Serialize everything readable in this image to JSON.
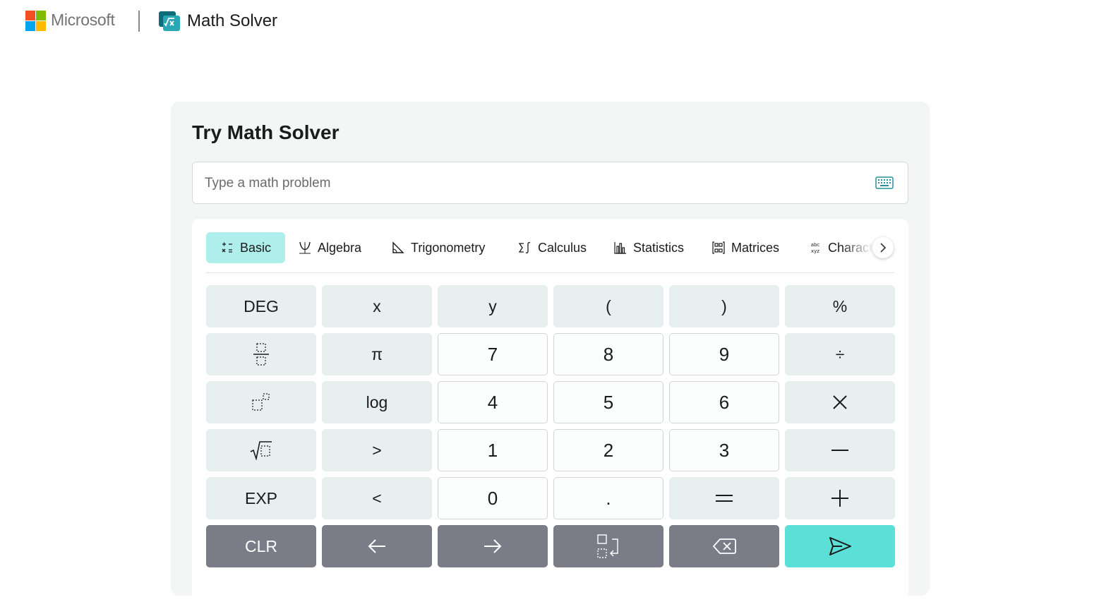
{
  "header": {
    "brand": "Microsoft",
    "app_name": "Math Solver",
    "logo_colors": [
      "#f25022",
      "#7fba00",
      "#00a4ef",
      "#ffb900"
    ]
  },
  "card": {
    "title": "Try Math Solver",
    "input": {
      "value": "",
      "placeholder": "Type a math problem",
      "icon": "keyboard-icon"
    }
  },
  "tabs": [
    {
      "label": "Basic",
      "icon": "basic-ops-icon",
      "active": true
    },
    {
      "label": "Algebra",
      "icon": "parabola-icon",
      "active": false
    },
    {
      "label": "Trigonometry",
      "icon": "triangle-icon",
      "active": false
    },
    {
      "label": "Calculus",
      "icon": "sigma-integral-icon",
      "active": false
    },
    {
      "label": "Statistics",
      "icon": "bar-chart-icon",
      "active": false
    },
    {
      "label": "Matrices",
      "icon": "matrix-icon",
      "active": false
    },
    {
      "label": "Characters",
      "icon": "abc-icon",
      "active": false
    }
  ],
  "keys": {
    "deg": "DEG",
    "x": "x",
    "y": "y",
    "lparen": "(",
    "rparen": ")",
    "percent": "%",
    "pi": "π",
    "seven": "7",
    "eight": "8",
    "nine": "9",
    "divide": "÷",
    "log": "log",
    "four": "4",
    "five": "5",
    "six": "6",
    "gt": ">",
    "one": "1",
    "two": "2",
    "three": "3",
    "exp": "EXP",
    "lt": "<",
    "zero": "0",
    "dot": ".",
    "equals": "=",
    "clr": "CLR"
  },
  "colors": {
    "accent_active_tab": "#aeeeeb",
    "submit": "#5cdfd6",
    "dark_key": "#7a7d87",
    "fn_key": "#e8f0ef"
  }
}
